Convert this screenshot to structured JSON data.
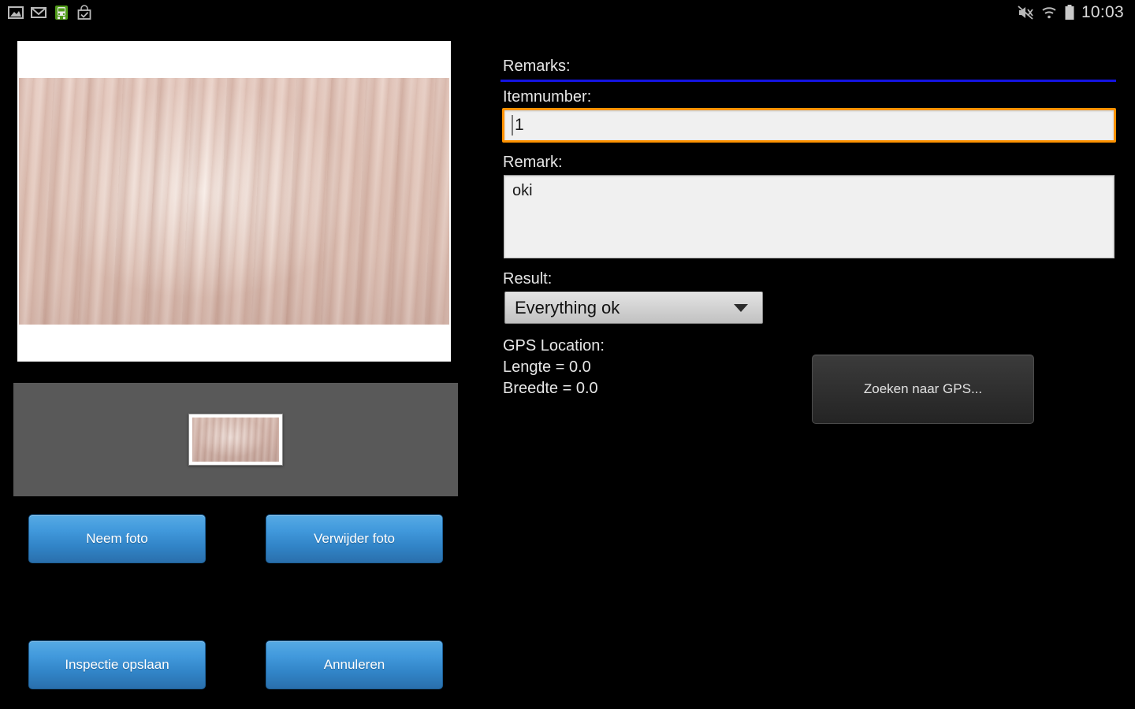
{
  "status_bar": {
    "left_icons": [
      {
        "name": "gallery-icon",
        "label": "Gallery"
      },
      {
        "name": "mail-icon",
        "label": "Mail"
      },
      {
        "name": "train-icon",
        "label": "Train"
      },
      {
        "name": "shopping-bag-check-icon",
        "label": "Store"
      }
    ],
    "right_icons": [
      {
        "name": "mute-icon",
        "label": "Sound muted"
      },
      {
        "name": "wifi-icon",
        "label": "Wi-Fi"
      },
      {
        "name": "battery-icon",
        "label": "Battery"
      }
    ],
    "time": "10:03"
  },
  "photo": {
    "preview_alt": "Inspection photo preview",
    "thumbnail_alt": "Inspection photo thumbnail"
  },
  "buttons": {
    "take_photo": "Neem foto",
    "delete_photo": "Verwijder foto",
    "save_inspection": "Inspectie opslaan",
    "cancel": "Annuleren",
    "search_gps": "Zoeken naar GPS..."
  },
  "form": {
    "remarks_label": "Remarks:",
    "itemnumber_label": "Itemnumber:",
    "itemnumber_value": "1",
    "itemnumber_placeholder": "",
    "remark_label": "Remark:",
    "remark_value": "oki",
    "remark_placeholder": "",
    "result_label": "Result:",
    "result_value": "Everything ok",
    "result_options": [
      "Everything ok"
    ]
  },
  "gps": {
    "title": "GPS Location:",
    "length_line": "Lengte = 0.0",
    "width_line": "Breedte = 0.0"
  },
  "colors": {
    "background": "#000000",
    "focus_border": "#ff9200",
    "divider": "#1313e0",
    "button_blue": "#3184c7",
    "gallery_strip": "#595959",
    "text": "#e6e6e6"
  }
}
